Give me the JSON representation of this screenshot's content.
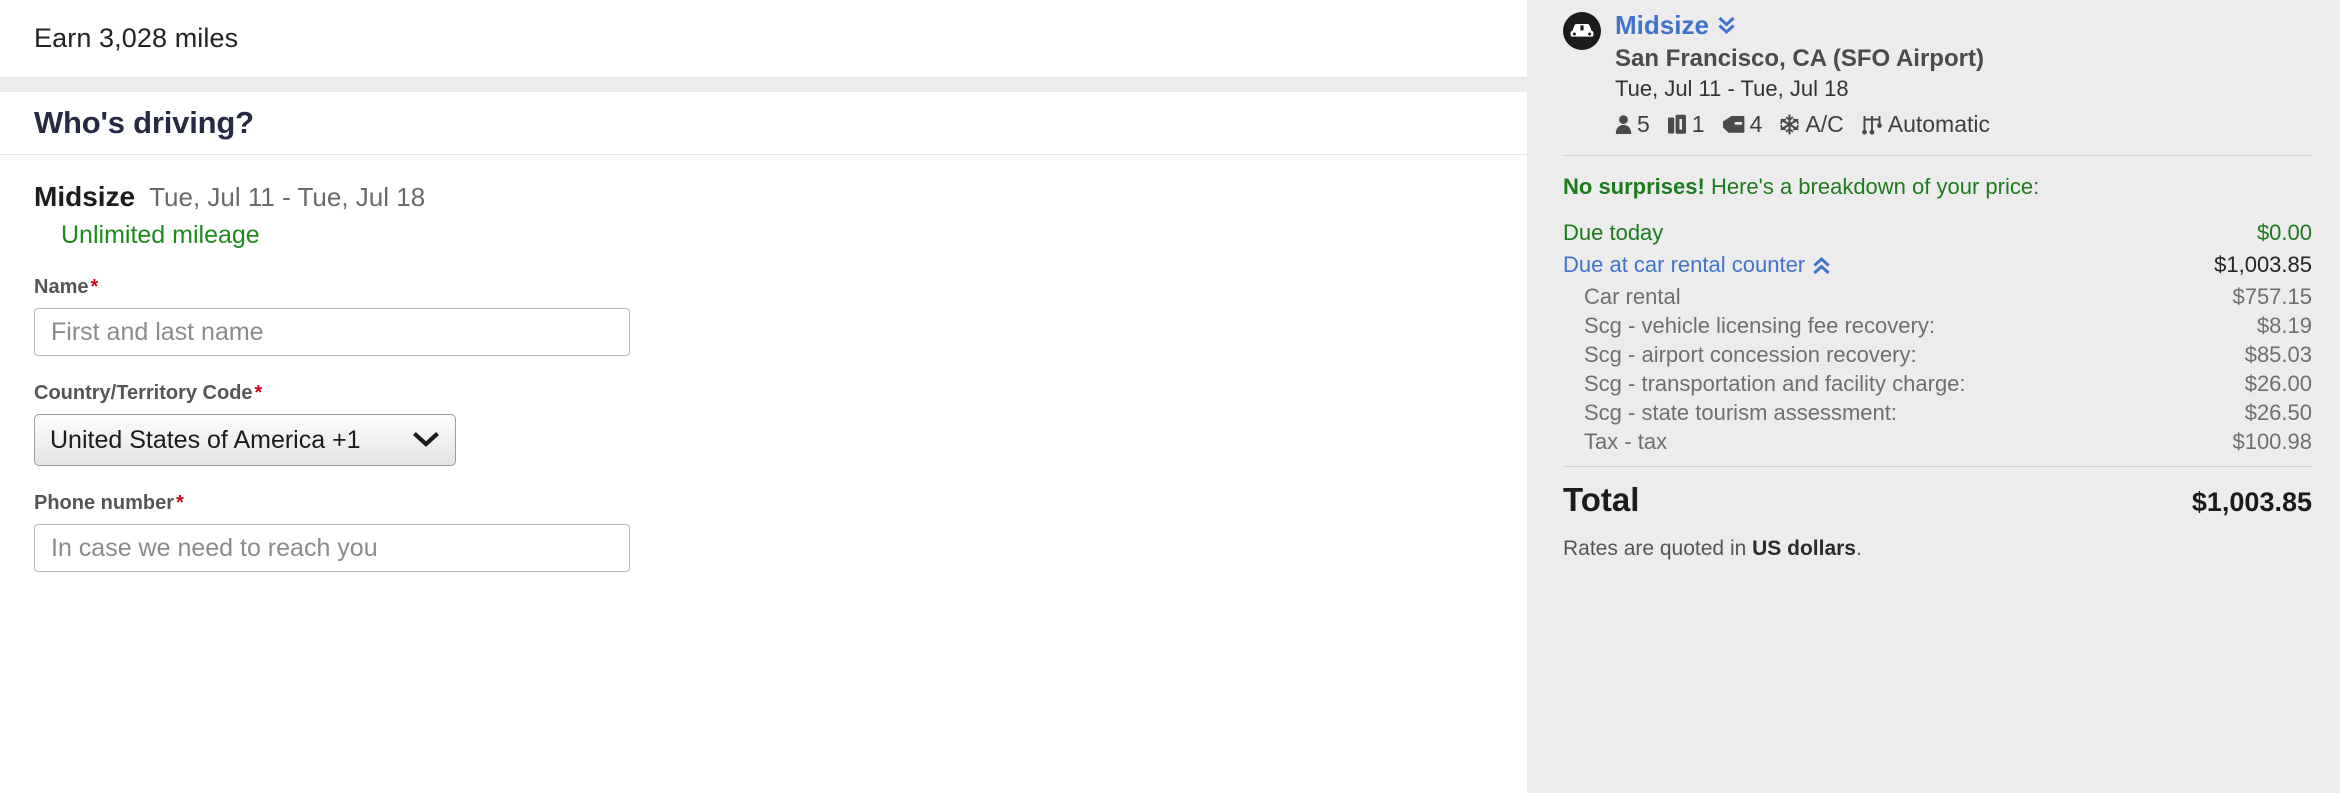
{
  "left": {
    "earn_banner": "Earn 3,028 miles",
    "section_title": "Who's driving?",
    "vehicle": {
      "name": "Midsize",
      "dates": "Tue, Jul 11 - Tue, Jul 18",
      "mileage": "Unlimited mileage"
    },
    "form": {
      "name_label": "Name",
      "name_required_mark": "*",
      "name_placeholder": "First and last name",
      "name_value": "",
      "country_label": "Country/Territory Code",
      "country_required_mark": "*",
      "country_selected": "United States of America +1",
      "phone_label": "Phone number",
      "phone_required_mark": "*",
      "phone_placeholder": "In case we need to reach you",
      "phone_value": ""
    }
  },
  "sidebar": {
    "car_type": "Midsize",
    "car_type_icon": "chevron-double-down-icon",
    "vehicle_icon": "car-icon",
    "location": "San Francisco, CA (SFO Airport)",
    "dates": "Tue, Jul 11 - Tue, Jul 18",
    "specs": [
      {
        "icon": "passenger-icon",
        "value": "5"
      },
      {
        "icon": "luggage-icon",
        "value": "1"
      },
      {
        "icon": "car-door-icon",
        "value": "4"
      },
      {
        "icon": "snowflake-icon",
        "value": "A/C"
      },
      {
        "icon": "transmission-icon",
        "value": "Automatic"
      }
    ],
    "no_surprises_bold": "No surprises!",
    "no_surprises_rest": " Here's a breakdown of your price:",
    "due_today_label": "Due today",
    "due_today_value": "$0.00",
    "due_counter_label": "Due at car rental counter",
    "due_counter_icon": "chevron-double-up-icon",
    "due_counter_value": "$1,003.85",
    "line_items": [
      {
        "label": "Car rental",
        "value": "$757.15"
      },
      {
        "label": "Scg - vehicle licensing fee recovery:",
        "value": "$8.19"
      },
      {
        "label": "Scg - airport concession recovery:",
        "value": "$85.03"
      },
      {
        "label": "Scg - transportation and facility charge:",
        "value": "$26.00"
      },
      {
        "label": "Scg - state tourism assessment:",
        "value": "$26.50"
      },
      {
        "label": "Tax - tax",
        "value": "$100.98"
      }
    ],
    "total_label": "Total",
    "total_value": "$1,003.85",
    "rates_note_prefix": "Rates are quoted in ",
    "rates_note_currency": "US dollars",
    "rates_note_suffix": "."
  },
  "colors": {
    "link_blue": "#4173cd",
    "green": "#1d7a1d",
    "required_red": "#d0021b",
    "heading_navy": "#242b42"
  }
}
